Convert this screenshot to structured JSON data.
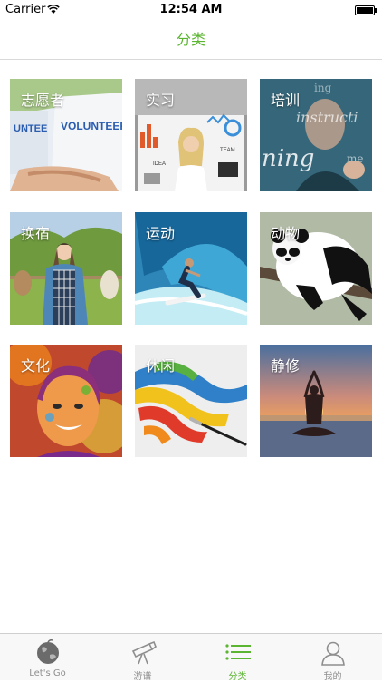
{
  "status_bar": {
    "carrier": "Carrier",
    "time": "12:54 AM"
  },
  "nav": {
    "title": "分类"
  },
  "categories": [
    {
      "label": "志愿者"
    },
    {
      "label": "实习"
    },
    {
      "label": "培训"
    },
    {
      "label": "换宿"
    },
    {
      "label": "运动"
    },
    {
      "label": "动物"
    },
    {
      "label": "文化"
    },
    {
      "label": "休闲"
    },
    {
      "label": "静修"
    }
  ],
  "tabs": [
    {
      "label": "Let's Go",
      "icon": "globe-icon",
      "active": false
    },
    {
      "label": "游谱",
      "icon": "telescope-icon",
      "active": false
    },
    {
      "label": "分类",
      "icon": "list-icon",
      "active": true
    },
    {
      "label": "我的",
      "icon": "person-icon",
      "active": false
    }
  ],
  "colors": {
    "accent": "#5bb531",
    "tab_inactive": "#8e8e8e"
  }
}
